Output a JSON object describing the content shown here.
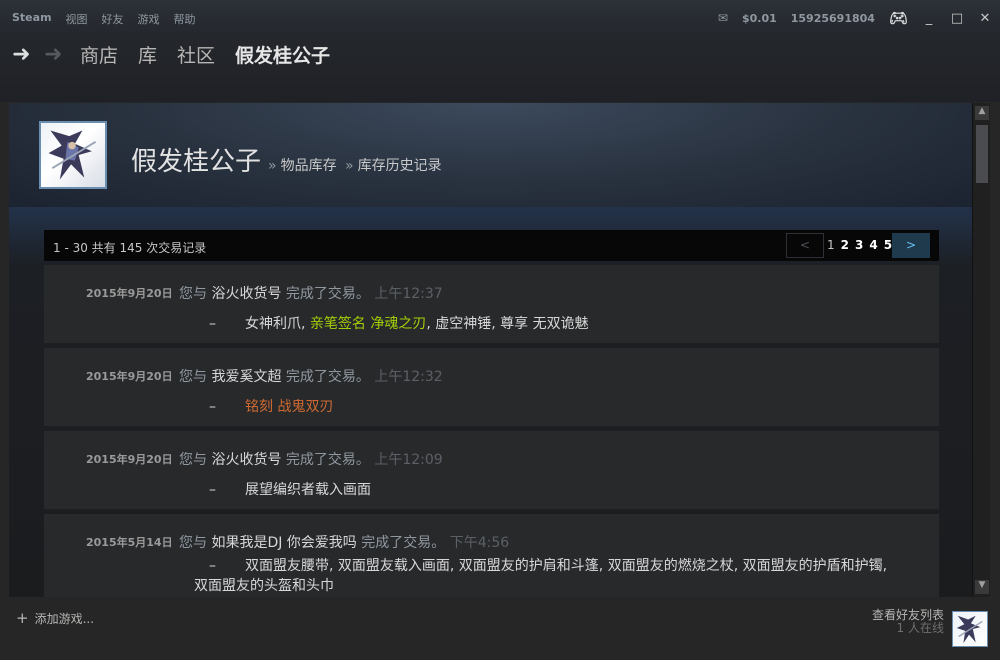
{
  "menu": {
    "items": [
      "Steam",
      "视图",
      "好友",
      "游戏",
      "帮助"
    ]
  },
  "status": {
    "balance": "$0.01",
    "account": "15925691804"
  },
  "nav": {
    "links": [
      "商店",
      "库",
      "社区"
    ],
    "active": "假发桂公子"
  },
  "profile": {
    "name": "假发桂公子",
    "crumb1": "物品库存",
    "crumb2": "库存历史记录",
    "separator": "»"
  },
  "pager": {
    "count_text": "1 - 30 共有 145 次交易记录",
    "prev": "<",
    "next": ">",
    "pages": [
      "1",
      "2",
      "3",
      "4",
      "5"
    ]
  },
  "trades": [
    {
      "date": "2015年9月20日",
      "prefix": "您与",
      "partner": "浴火收货号",
      "suffix": "完成了交易。",
      "time": "上午12:37",
      "dash": "–",
      "item_plain1": "女神利爪, ",
      "item_green": "亲笔签名 净魂之刃",
      "item_plain2": ", 虚空神锤, 尊享 无双诡魅"
    },
    {
      "date": "2015年9月20日",
      "prefix": "您与",
      "partner": "我爱奚文超",
      "suffix": "完成了交易。",
      "time": "上午12:32",
      "dash": "–",
      "item_orange": "铭刻 战鬼双刃"
    },
    {
      "date": "2015年9月20日",
      "prefix": "您与",
      "partner": "浴火收货号",
      "suffix": "完成了交易。",
      "time": "上午12:09",
      "dash": "–",
      "item_plain": "展望编织者载入画面"
    },
    {
      "date": "2015年5月14日",
      "prefix": "您与",
      "partner": "如果我是DJ 你会爱我吗",
      "suffix": "完成了交易。",
      "time": "下午4:56",
      "dash": "–",
      "item_line1": "双面盟友腰带, 双面盟友载入画面, 双面盟友的护肩和斗篷, 双面盟友的燃烧之杖, 双面盟友的护盾和护镯,",
      "item_line2": "双面盟友的头盔和头巾"
    }
  ],
  "bottom": {
    "add_game": "添加游戏...",
    "plus": "+",
    "friends_list": "查看好友列表",
    "online": "1 人在线"
  },
  "colors": {
    "accent_link": "#67c1f5",
    "autographed": "#a4d007",
    "inscribed": "#cf6a32"
  }
}
